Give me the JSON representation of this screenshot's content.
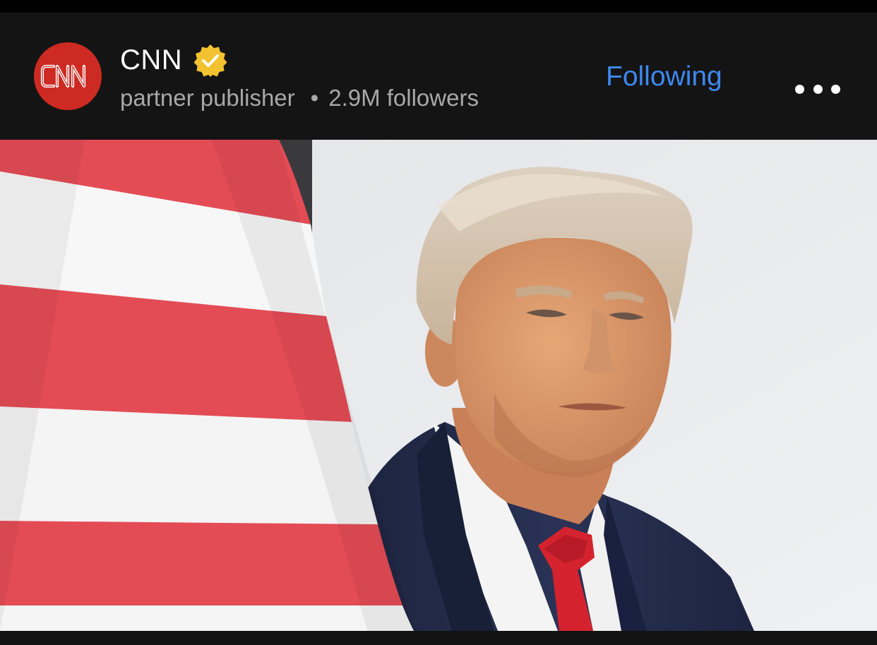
{
  "post_header": {
    "publisher_name": "CNN",
    "avatar_logo_text": "CNN",
    "verified_icon": "verified-badge-icon",
    "publisher_type": "partner publisher",
    "separator": "•",
    "followers": "2.9M followers",
    "follow_state_label": "Following",
    "more_icon": "more-options-icon"
  },
  "post_image": {
    "content": "photo"
  },
  "colors": {
    "header_background": "#141414",
    "brand_red": "#cc2a22",
    "accent_blue": "#3e88f0",
    "verified_gold": "#f2c230",
    "muted_text": "#a8a8a8"
  }
}
